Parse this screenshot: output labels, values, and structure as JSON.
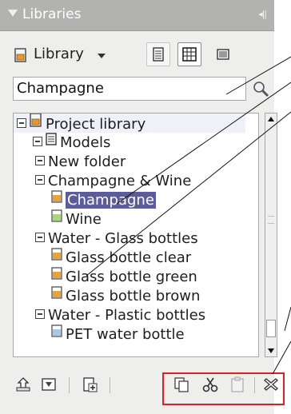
{
  "panel": {
    "title": "Libraries",
    "collapse_glyph": "◂||"
  },
  "library_selector": {
    "label": "Library"
  },
  "search": {
    "value": "Champagne"
  },
  "tree": [
    {
      "label": "Project library",
      "icon": "library-icon",
      "toggle": true,
      "level": 0
    },
    {
      "label": "Models",
      "icon": "models-icon",
      "toggle": true,
      "level": 1
    },
    {
      "label": "New folder",
      "icon": null,
      "toggle": true,
      "level": 2
    },
    {
      "label": "Champagne & Wine",
      "icon": null,
      "toggle": true,
      "level": 2
    },
    {
      "label": "Champagne",
      "icon": "material-orange-icon",
      "toggle": false,
      "level": 3,
      "selected": true
    },
    {
      "label": "Wine",
      "icon": "material-green-icon",
      "toggle": false,
      "level": 3
    },
    {
      "label": "Water - Glass bottles",
      "icon": null,
      "toggle": true,
      "level": 2
    },
    {
      "label": "Glass bottle clear",
      "icon": "material-orange-icon",
      "toggle": false,
      "level": 3
    },
    {
      "label": "Glass bottle green",
      "icon": "material-orange-icon",
      "toggle": false,
      "level": 3
    },
    {
      "label": "Glass bottle brown",
      "icon": "material-orange-icon",
      "toggle": false,
      "level": 3
    },
    {
      "label": "Water - Plastic bottles",
      "icon": null,
      "toggle": true,
      "level": 2
    },
    {
      "label": "PET water bottle",
      "icon": "material-blue-icon",
      "toggle": false,
      "level": 3
    }
  ],
  "colors": {
    "selection": "#5b5d9a",
    "title_bar": "#b2b2b0",
    "highlight_box": "#e02020"
  }
}
